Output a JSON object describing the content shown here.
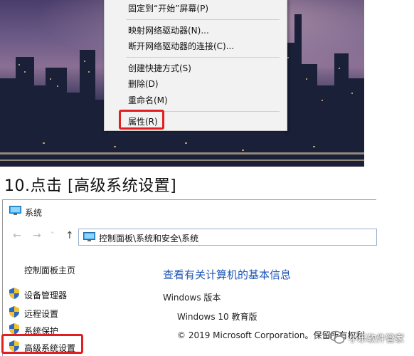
{
  "context_menu": {
    "items": [
      {
        "label": "固定到“开始”屏幕(P)"
      },
      {
        "label": "映射网络驱动器(N)..."
      },
      {
        "label": "断开网络驱动器的连接(C)..."
      },
      {
        "label": "创建快捷方式(S)"
      },
      {
        "label": "删除(D)"
      },
      {
        "label": "重命名(M)"
      },
      {
        "label": "属性(R)"
      }
    ]
  },
  "step_heading": "10.点击 [高级系统设置]",
  "system_window": {
    "title": "系统",
    "address": "控制面板\\系统和安全\\系统",
    "nav": {
      "back": "←",
      "forward": "→",
      "history": "˅",
      "up": "↑"
    },
    "left_pane": {
      "home_link": "控制面板主页",
      "links": [
        {
          "label": "设备管理器"
        },
        {
          "label": "远程设置"
        },
        {
          "label": "系统保护"
        },
        {
          "label": "高级系统设置"
        }
      ]
    },
    "main": {
      "title": "查看有关计算机的基本信息",
      "edition_label": "Windows 版本",
      "edition_value": "Windows 10 教育版",
      "copyright": "© 2019 Microsoft Corporation。保留所有权利"
    }
  },
  "watermark": {
    "text": "小乐软件管家"
  },
  "colors": {
    "highlight": "#e02020",
    "link_blue": "#1f57b5",
    "menu_bg": "#f2f2f2"
  }
}
